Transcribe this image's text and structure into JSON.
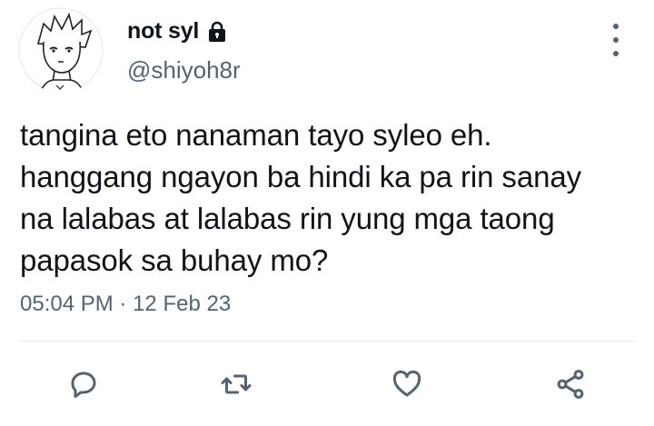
{
  "tweet": {
    "display_name": "not syl",
    "handle": "@shiyoh8r",
    "text": "tangina eto nanaman tayo syleo eh.\nhanggang ngayon ba hindi ka pa rin sanay\nna lalabas at lalabas rin yung mga taong\npapasok sa buhay mo?",
    "time": "05:04 PM",
    "separator": "·",
    "date": "12 Feb 23"
  },
  "icons": {
    "avatar": "anime-avatar",
    "protected": "lock-icon",
    "more": "more-vertical-icon",
    "reply": "reply-icon",
    "retweet": "retweet-icon",
    "like": "heart-icon",
    "share": "share-icon"
  },
  "colors": {
    "text": "#0f1419",
    "secondary": "#536471",
    "divider": "#e6ecf0"
  }
}
